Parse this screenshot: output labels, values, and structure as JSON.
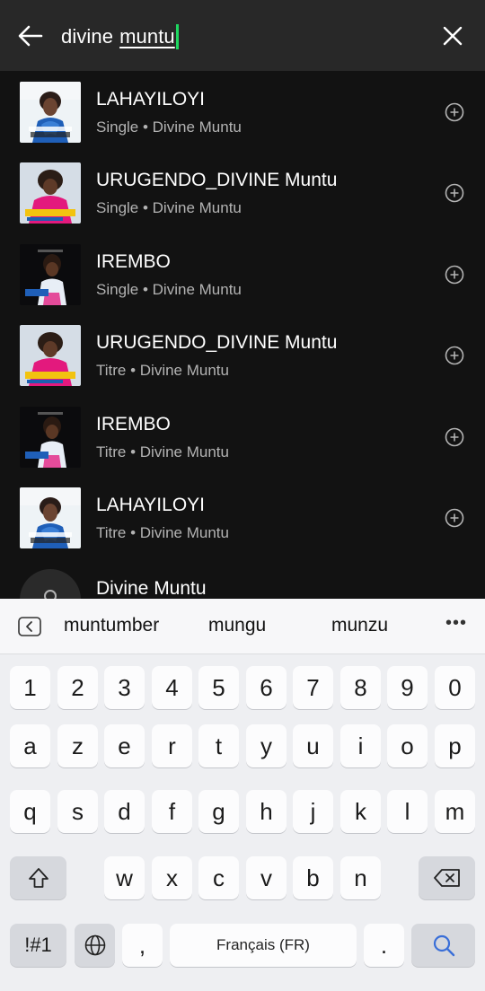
{
  "search": {
    "query_prefix": "divine",
    "query_composing": "muntu"
  },
  "results": [
    {
      "title": "LAHAYILOYI",
      "subtitle": "Single • Divine Muntu",
      "cover": "lahayiloyi"
    },
    {
      "title": "URUGENDO_DIVINE Muntu",
      "subtitle": "Single • Divine Muntu",
      "cover": "urugendo"
    },
    {
      "title": "IREMBO",
      "subtitle": "Single • Divine Muntu",
      "cover": "irembo"
    },
    {
      "title": "URUGENDO_DIVINE Muntu",
      "subtitle": "Titre • Divine Muntu",
      "cover": "urugendo"
    },
    {
      "title": "IREMBO",
      "subtitle": "Titre • Divine Muntu",
      "cover": "irembo"
    },
    {
      "title": "LAHAYILOYI",
      "subtitle": "Titre • Divine Muntu",
      "cover": "lahayiloyi"
    },
    {
      "title": "Divine Muntu",
      "subtitle": "",
      "cover": "artist"
    }
  ],
  "keyboard": {
    "suggestions": [
      "muntumber",
      "mungu",
      "munzu"
    ],
    "more_label": "•••",
    "row_numbers": [
      "1",
      "2",
      "3",
      "4",
      "5",
      "6",
      "7",
      "8",
      "9",
      "0"
    ],
    "row1": [
      "a",
      "z",
      "e",
      "r",
      "t",
      "y",
      "u",
      "i",
      "o",
      "p"
    ],
    "row2": [
      "q",
      "s",
      "d",
      "f",
      "g",
      "h",
      "j",
      "k",
      "l",
      "m"
    ],
    "row3": [
      "w",
      "x",
      "c",
      "v",
      "b",
      "n"
    ],
    "symbols_label": "!#1",
    "comma_label": ",",
    "space_label": "Français (FR)",
    "period_label": "."
  },
  "colors": {
    "background": "#121212",
    "header": "#282828",
    "caret": "#1ed760",
    "subtitle": "#b3b3b3",
    "search_key_icon": "#3a6fd8"
  },
  "icons": {
    "back": "arrow-left-icon",
    "clear": "close-icon",
    "add": "plus-circle-icon",
    "shift": "shift-icon",
    "backspace": "backspace-icon",
    "globe": "globe-icon",
    "search": "search-icon",
    "suggest_toggle": "chevron-left-box-icon"
  }
}
